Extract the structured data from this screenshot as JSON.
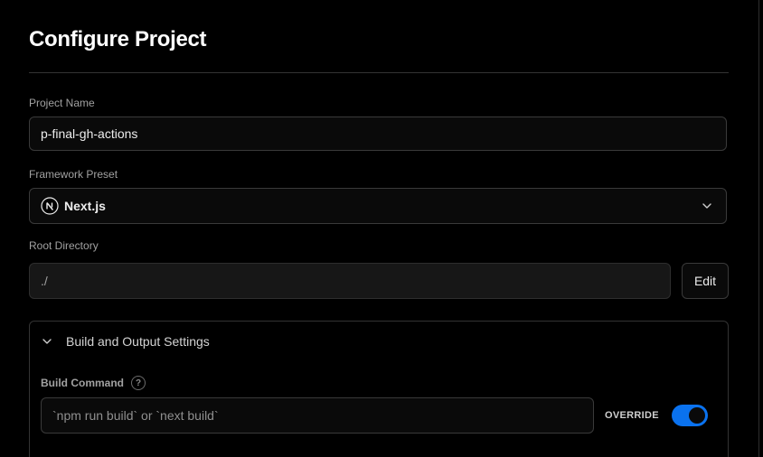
{
  "page": {
    "title": "Configure Project"
  },
  "project_name": {
    "label": "Project Name",
    "value": "p-final-gh-actions"
  },
  "framework_preset": {
    "label": "Framework Preset",
    "value": "Next.js",
    "icon": "nextjs-logo-icon"
  },
  "root_directory": {
    "label": "Root Directory",
    "value": "./",
    "edit_label": "Edit"
  },
  "build_settings": {
    "header": "Build and Output Settings",
    "build_command": {
      "label": "Build Command",
      "help_glyph": "?",
      "placeholder": "`npm run build` or `next build`",
      "override_label": "OVERRIDE",
      "override_enabled": true
    }
  },
  "colors": {
    "background": "#000000",
    "accent": "#0a72ef",
    "border": "#333333"
  }
}
